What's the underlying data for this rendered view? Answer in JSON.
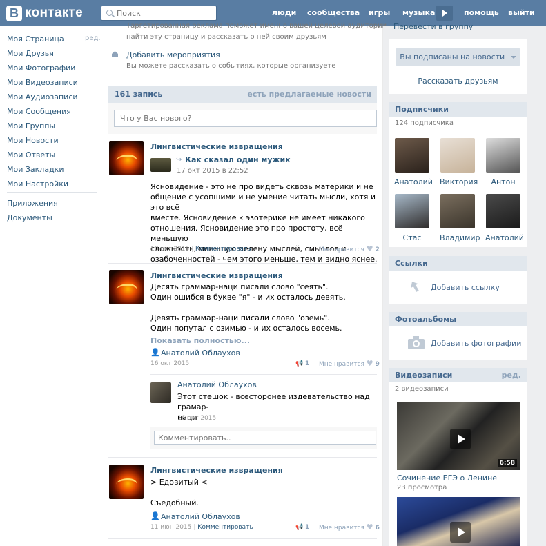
{
  "header": {
    "logo_letter": "В",
    "logo_text": "контакте",
    "search_placeholder": "Поиск",
    "nav": [
      "люди",
      "сообщества",
      "игры",
      "музыка",
      "помощь",
      "выйти"
    ]
  },
  "leftmenu": {
    "items": [
      "Моя Страница",
      "Мои Друзья",
      "Мои Фотографии",
      "Мои Видеозаписи",
      "Мои Аудиозаписи",
      "Мои Сообщения",
      "Мои Группы",
      "Мои Новости",
      "Мои Ответы",
      "Мои Закладки",
      "Мои Настройки"
    ],
    "extra": [
      "Приложения",
      "Документы"
    ],
    "edit_label": "ред."
  },
  "top": {
    "cut_line1": "Таргетированная реклама поможет именно вашей целевой аудитории",
    "cut_line2": "найти эту страницу и рассказать о ней своим друзьям",
    "event_title": "Добавить мероприятия",
    "event_desc": "Вы можете рассказать о событиях, которые организуете"
  },
  "wall": {
    "count": "161 запись",
    "suggested": "есть предлагаемые новости",
    "post_placeholder": "Что у Вас нового?"
  },
  "posts": [
    {
      "author": "Лингвистические извращения",
      "repost_title": "Как сказал один мужик",
      "repost_date": "17 окт 2015 в 22:52",
      "lines": [
        "Ясновидение - это не про видеть сквозь материки и не",
        "общение с усопшими и не умение читать мысли, хотя и это всё",
        "вместе. Ясновидение к эзотерике не имеет никакого",
        "отношения. Ясновидение это про простоту, всё меньшую",
        "сложность, меньшую пелену мыслей, смыслов и",
        "озабоченностей - чем этого меньше, тем и видно яснее."
      ],
      "date": "18 окт 2015",
      "comment": "Комментировать",
      "like_label": "Мне нравится",
      "likes": "2"
    },
    {
      "author": "Лингвистические извращения",
      "lines": [
        "Десять граммар-наци писали слово \"сеять\".",
        "Один ошибся в букве \"я\" - и их осталось девять.",
        "",
        "Девять граммар-наци писали слово \"оземь\".",
        "Один попутал с озимью - и их осталось восемь."
      ],
      "show_more": "Показать полностью...",
      "signer": "Анатолий Облаухов",
      "date": "16 окт 2015",
      "shares": "1",
      "like_label": "Мне нравится",
      "likes": "9",
      "reply": {
        "author": "Анатолий Облаухов",
        "lines": [
          "Этот стешок - всесторонее издевательство над грамар-",
          "наци"
        ],
        "date": "16 окт 2015"
      },
      "comment_placeholder": "Комментировать.."
    },
    {
      "author": "Лингвистические извращения",
      "lines": [
        "> Едовитый <",
        "",
        "Съедобный."
      ],
      "signer": "Анатолий Облаухов",
      "date": "11 июн 2015",
      "comment": "Комментировать",
      "shares": "1",
      "like_label": "Мне нравится",
      "likes": "6"
    }
  ],
  "right": {
    "top_link": "Перевести в группу",
    "subscribed_btn": "Вы подписаны на новости",
    "tell_friends": "Рассказать друзьям",
    "subscribers_title": "Подписчики",
    "subscribers_count": "124 подписчика",
    "subscribers": [
      "Анатолий",
      "Виктория",
      "Антон",
      "Стас",
      "Владимир",
      "Анатолий"
    ],
    "links_title": "Ссылки",
    "add_link": "Добавить ссылку",
    "albums_title": "Фотоальбомы",
    "add_photos": "Добавить фотографии",
    "videos_title": "Видеозаписи",
    "videos_edit": "ред.",
    "videos_count": "2 видеозаписи",
    "video1_duration": "6:58",
    "video1_title": "Сочинение ЕГЭ о Ленине",
    "video1_views": "23 просмотра"
  },
  "colors": {
    "header": "#597da3",
    "link": "#2b587a",
    "block_head": "#e1e7ed"
  }
}
